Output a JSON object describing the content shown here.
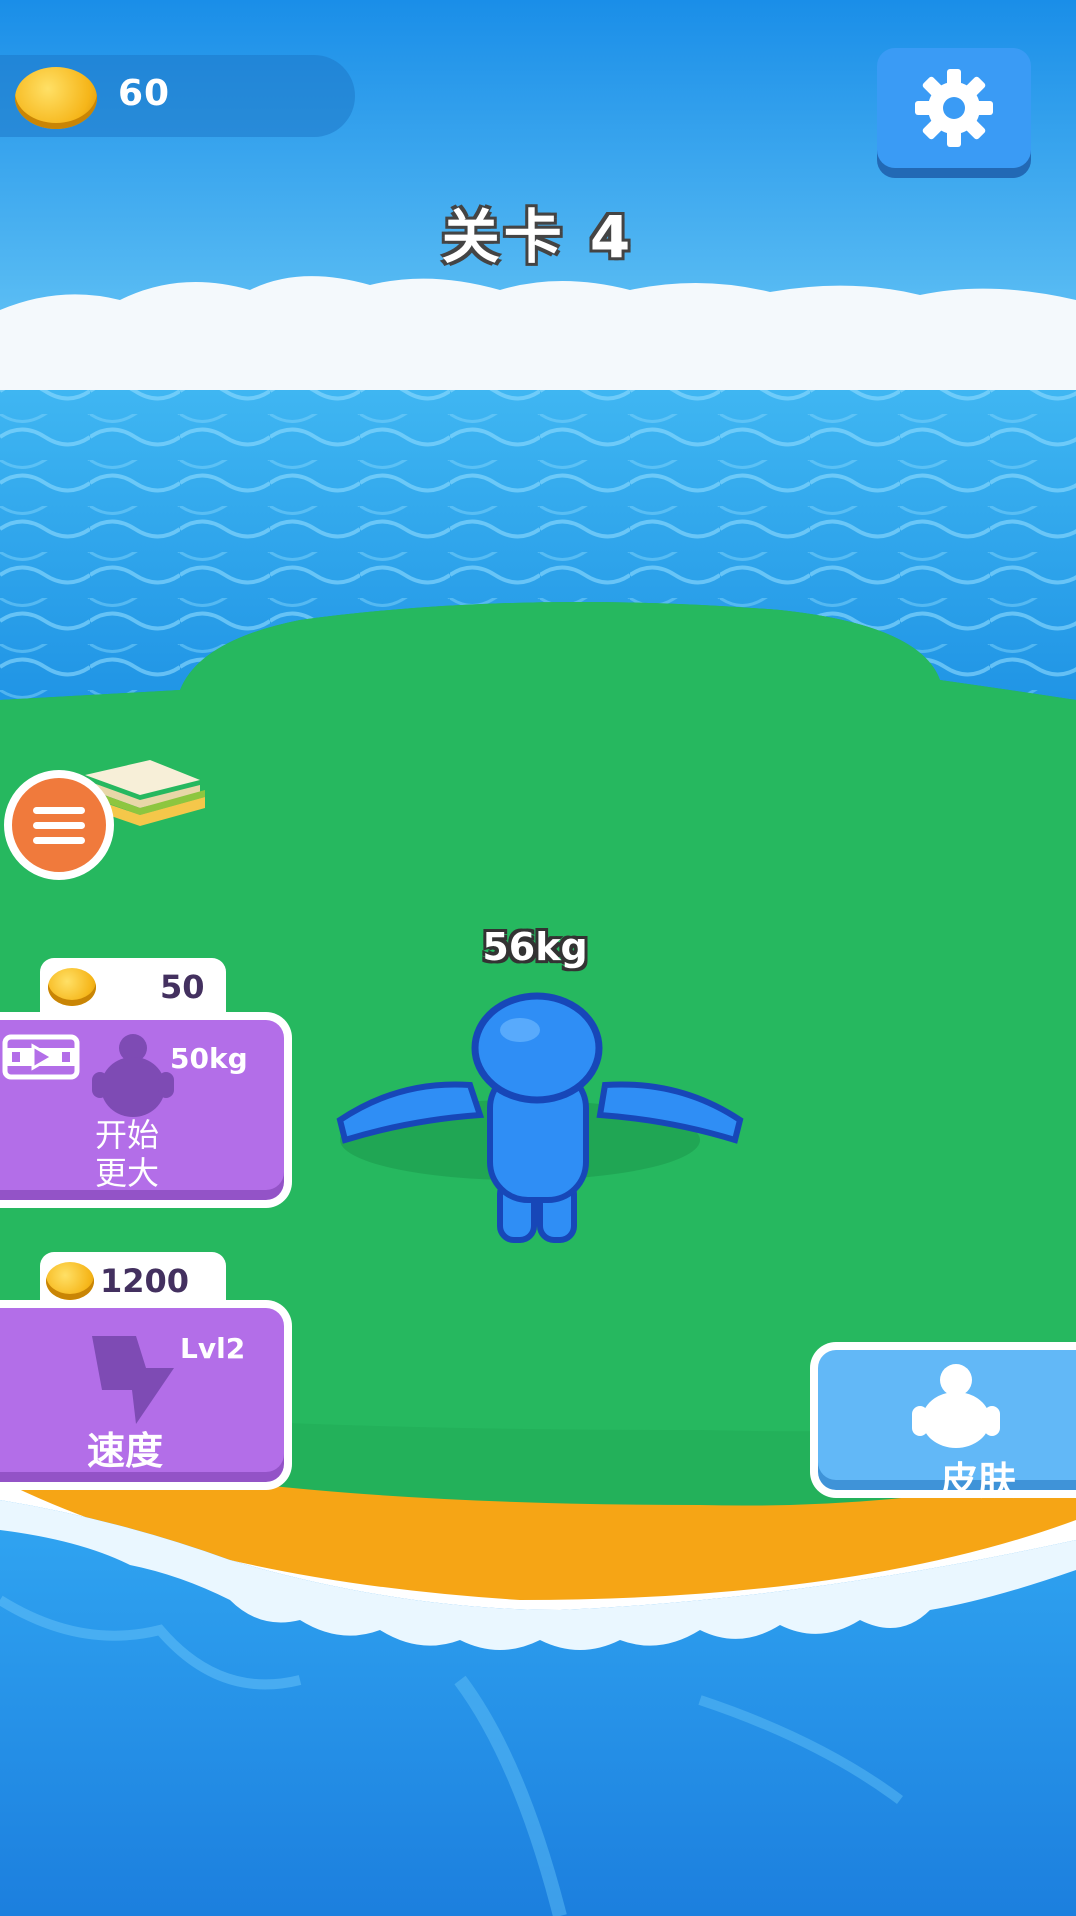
{
  "hud": {
    "coins": "60",
    "level_title": "关卡 4"
  },
  "player": {
    "weight": "56kg"
  },
  "upgrades": {
    "start_bigger": {
      "price": "50",
      "target_weight": "50kg",
      "label_line1": "开始",
      "label_line2": "更大"
    },
    "speed": {
      "price": "1200",
      "level": "Lvl2",
      "label": "速度"
    }
  },
  "skin": {
    "label": "皮肤"
  },
  "icons": {
    "coin": "coin-icon",
    "settings": "gear-icon",
    "menu": "menu-icon",
    "video": "video-icon",
    "fat_body": "fat-figure-icon",
    "speed": "lightning-icon",
    "skin": "body-icon",
    "food": "sandwich-icon"
  },
  "colors": {
    "ocean": "#2aa7f0",
    "grass": "#23b15a",
    "sand": "#f6a515",
    "upgrade_card": "#b36ee8",
    "skin_button": "#62b8f7",
    "settings_button": "#3a9bf5",
    "menu_button": "#f07a3c",
    "player": "#2f8ef5"
  }
}
